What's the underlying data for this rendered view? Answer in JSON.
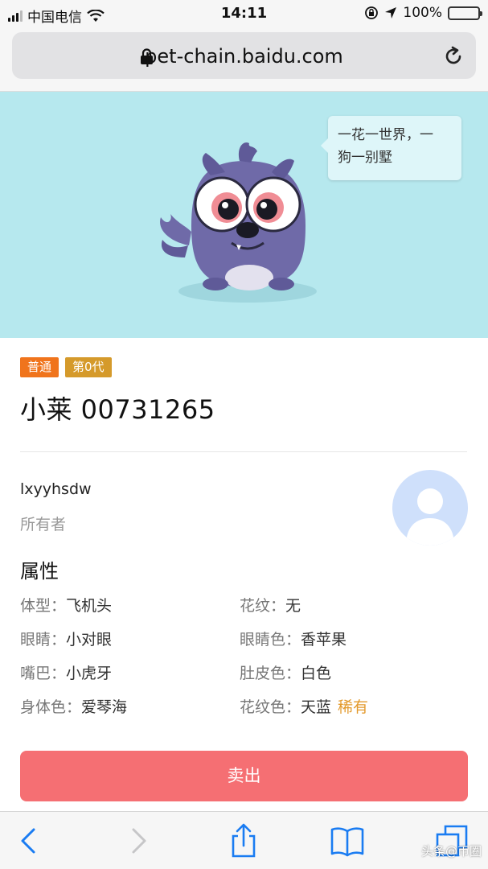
{
  "status_bar": {
    "carrier": "中国电信",
    "time": "14:11",
    "battery": "100%",
    "battery_level": 1.0
  },
  "browser": {
    "url": "pet-chain.baidu.com"
  },
  "hero": {
    "background": "#b6e8ee",
    "speech_bubble_line1": "一花一世界，一",
    "speech_bubble_line2": "狗一别墅"
  },
  "pet": {
    "badges": [
      "普通",
      "第0代"
    ],
    "name": "小莱 00731265",
    "owner_name": "lxyyhsdw",
    "owner_label": "所有者"
  },
  "attributes": {
    "title": "属性",
    "items": [
      {
        "key": "体型：",
        "value": "飞机头"
      },
      {
        "key": "花纹：",
        "value": "无"
      },
      {
        "key": "眼睛：",
        "value": "小对眼"
      },
      {
        "key": "眼睛色：",
        "value": "香苹果"
      },
      {
        "key": "嘴巴：",
        "value": "小虎牙"
      },
      {
        "key": "肚皮色：",
        "value": "白色"
      },
      {
        "key": "身体色：",
        "value": "爱琴海"
      },
      {
        "key": "花纹色：",
        "value": "天蓝",
        "tag": "稀有"
      }
    ]
  },
  "actions": {
    "sell_label": "卖出",
    "sell_color": "#f56f73"
  },
  "toolbar": {
    "icons": [
      "back-icon",
      "forward-icon",
      "share-icon",
      "bookmarks-icon",
      "tabs-icon"
    ]
  },
  "watermark": "头条@币圈"
}
